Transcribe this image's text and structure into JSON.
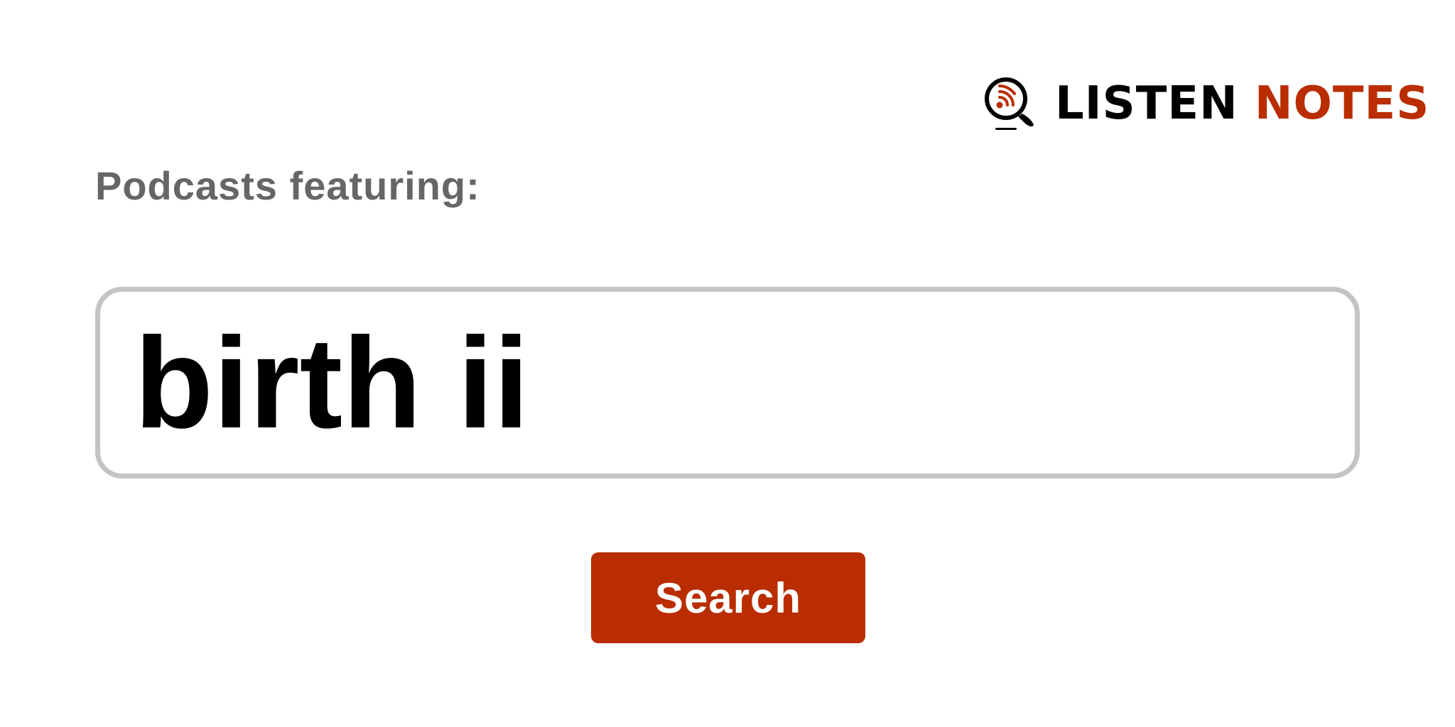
{
  "logo": {
    "icon": "podcast-search-icon",
    "word_listen": "LISTEN",
    "word_notes": "NOTES"
  },
  "heading": "Podcasts featuring:",
  "search": {
    "value": "birth ii",
    "button_label": "Search"
  },
  "colors": {
    "brand": "#b92d00",
    "text": "#000000",
    "label": "#666666",
    "border": "#c4c4c4"
  }
}
